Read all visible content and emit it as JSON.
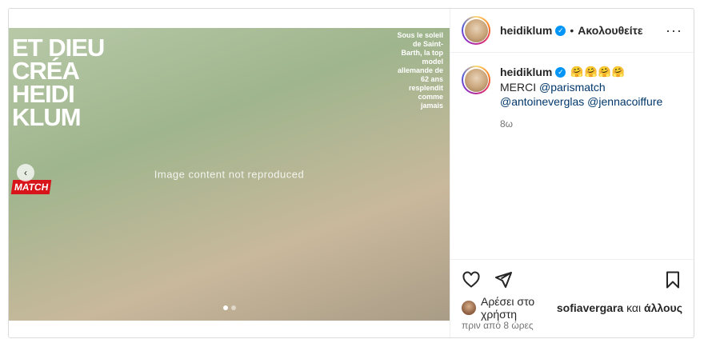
{
  "post": {
    "media": {
      "placeholder": "Image content not reproduced",
      "headline": "ET DIEU CRÉA HEIDI KLUM",
      "logo": "MATCH",
      "caption": "Sous le soleil de Saint-Barth, la top model allemande de 62 ans resplendit comme jamais",
      "slides": 2,
      "active_slide": 1
    },
    "header": {
      "username": "heidiklum",
      "verified": "✓",
      "separator": "•",
      "follow_status": "Ακολουθείτε",
      "more": "···"
    },
    "caption": {
      "username": "heidiklum",
      "emojis": "🤗🤗🤗🤗",
      "text_prefix": "MERCI",
      "mentions": [
        "@parismatch",
        "@antoineverglas",
        "@jennacoiffure"
      ],
      "age": "8ω"
    },
    "actions": {
      "like_icon": "heart-icon",
      "share_icon": "send-icon",
      "save_icon": "bookmark-icon"
    },
    "likes": {
      "prefix": "Αρέσει στο χρήστη",
      "user": "sofiavergara",
      "connector": "και",
      "others": "άλλους"
    },
    "timestamp": "πριν από 8 ώρες"
  }
}
